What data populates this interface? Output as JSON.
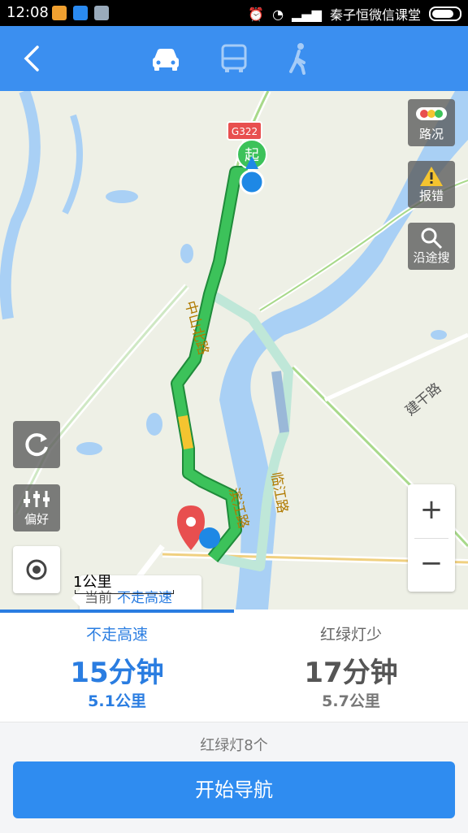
{
  "status_bar": {
    "time": "12:08",
    "carrier": "秦子恒微信课堂"
  },
  "map": {
    "road_badge": "G322",
    "start_marker": "起",
    "road_labels": [
      "中山北路",
      "滨江路",
      "临江路",
      "建干路"
    ],
    "traffic_label": "路况",
    "report_label": "报错",
    "search_label": "沿途搜",
    "preference_label": "偏好",
    "tooltip_prefix": "当前",
    "tooltip_value": "不走高速",
    "scale_text": "1公里",
    "colors": {
      "route_green": "#3cc25a",
      "route_slow": "#f4c430",
      "alt_route": "#bfe7d8",
      "water": "#a9d0f5"
    }
  },
  "routes": [
    {
      "name": "不走高速",
      "time": "15分钟",
      "distance": "5.1公里",
      "selected": true
    },
    {
      "name": "红绿灯少",
      "time": "17分钟",
      "distance": "5.7公里",
      "selected": false
    }
  ],
  "traffic_lights": "红绿灯8个",
  "navigate_button": "开始导航",
  "icons": [
    "back-icon",
    "car-icon",
    "bus-icon",
    "walk-icon",
    "traffic-light-icon",
    "warning-icon",
    "search-icon",
    "refresh-icon",
    "sliders-icon",
    "locate-icon",
    "zoom-in-icon",
    "zoom-out-icon",
    "destination-pin-icon"
  ]
}
